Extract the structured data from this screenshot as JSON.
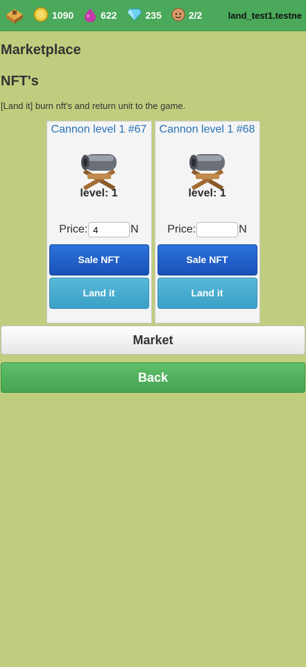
{
  "topbar": {
    "resources": [
      {
        "icon": "gold-coin-icon",
        "value": "1090"
      },
      {
        "icon": "elixir-icon",
        "value": "622"
      },
      {
        "icon": "gem-icon",
        "value": "235"
      },
      {
        "icon": "worker-icon",
        "value": "2/2"
      }
    ],
    "account": "land_test1.testne"
  },
  "page_title": "Marketplace",
  "section_title": "NFT's",
  "description": "[Land it] burn nft's and return unit to the game.",
  "cards": [
    {
      "title": "Cannon level 1 #67",
      "level": "level: 1",
      "price_label": "Price:",
      "price_value": "4",
      "price_unit": "N",
      "sale_label": "Sale NFT",
      "land_label": "Land it"
    },
    {
      "title": "Cannon level 1 #68",
      "level": "level: 1",
      "price_label": "Price:",
      "price_value": "",
      "price_unit": "N",
      "sale_label": "Sale NFT",
      "land_label": "Land it"
    }
  ],
  "market_label": "Market",
  "back_label": "Back"
}
